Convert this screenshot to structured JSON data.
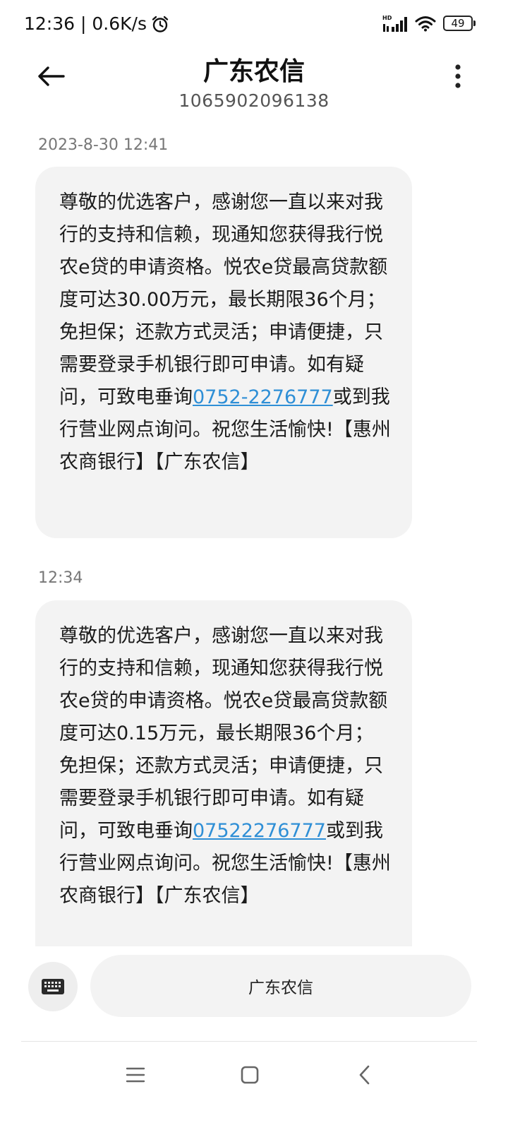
{
  "status_bar": {
    "time_speed": "12:36 | 0.6K/s",
    "network_tag": "HD",
    "battery": "49"
  },
  "header": {
    "contact_name": "广东农信",
    "contact_number": "1065902096138"
  },
  "messages": [
    {
      "timestamp": "2023-8-30 12:41",
      "text_before_link": "尊敬的优选客户，感谢您一直以来对我行的支持和信赖，现通知您获得我行悦农e贷的申请资格。悦农e贷最高贷款额度可达30.00万元，最长期限36个月；免担保；还款方式灵活；申请便捷，只需要登录手机银行即可申请。如有疑问，可致电垂询",
      "link": "0752-2276777",
      "text_after_link": "或到我行营业网点询问。祝您生活愉快!【惠州农商银行】【广东农信】"
    },
    {
      "timestamp": "12:34",
      "text_before_link": "尊敬的优选客户，感谢您一直以来对我行的支持和信赖，现通知您获得我行悦农e贷的申请资格。悦农e贷最高贷款额度可达0.15万元，最长期限36个月；免担保；还款方式灵活；申请便捷，只需要登录手机银行即可申请。如有疑问，可致电垂询",
      "link": "07522276777",
      "text_after_link": "或到我行营业网点询问。祝您生活愉快!【惠州农商银行】【广东农信】"
    }
  ],
  "composer": {
    "pill_label": "广东农信"
  },
  "colors": {
    "link": "#2f8fd6",
    "bubble_bg": "#f3f3f3",
    "timestamp": "#777777"
  },
  "icons": {
    "status": [
      "alarm-icon",
      "signal-icon",
      "wifi-icon",
      "battery-icon"
    ],
    "header": [
      "back-arrow-icon",
      "more-vertical-icon"
    ],
    "composer": [
      "keyboard-icon"
    ],
    "nav": [
      "menu-icon",
      "square-home-icon",
      "chevron-left-icon"
    ]
  }
}
